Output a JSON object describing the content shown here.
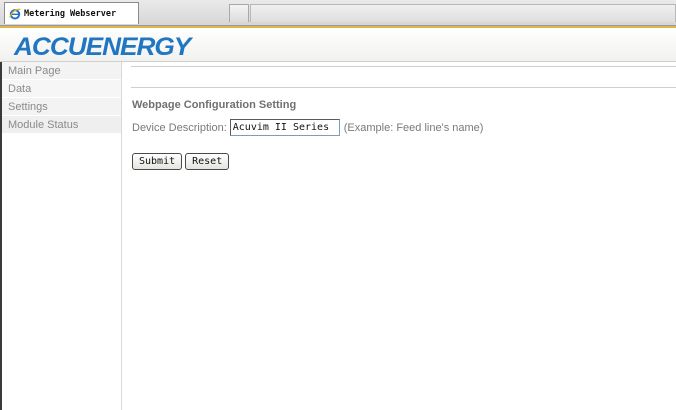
{
  "browser": {
    "tab_title": "Metering Webserver",
    "favicon": "ie-icon"
  },
  "header": {
    "logo_text": "ACCUENERGY",
    "logo_color": "#2176c2"
  },
  "sidebar": {
    "items": [
      {
        "label": "Main Page"
      },
      {
        "label": "Data"
      },
      {
        "label": "Settings"
      },
      {
        "label": "Module Status"
      }
    ]
  },
  "main": {
    "section_title": "Webpage Configuration Setting",
    "device_description": {
      "label": "Device Description:",
      "value": "Acuvim II Series",
      "hint": "(Example: Feed line's name)"
    },
    "buttons": {
      "submit": "Submit",
      "reset": "Reset"
    }
  }
}
